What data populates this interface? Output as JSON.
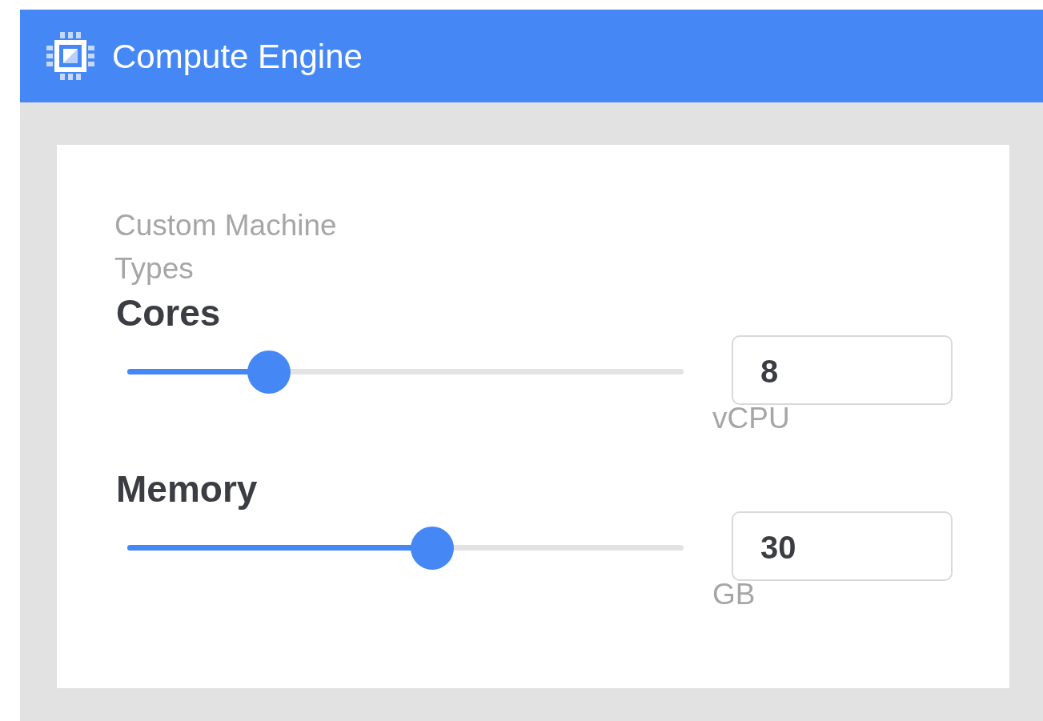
{
  "header": {
    "title": "Compute Engine"
  },
  "card": {
    "title": "Custom Machine Types",
    "sliders": [
      {
        "label": "Cores",
        "level": 0.255,
        "value": "8",
        "unit": "vCPU"
      },
      {
        "label": "Memory",
        "level": 0.548,
        "value": "30",
        "unit": "GB"
      }
    ]
  }
}
